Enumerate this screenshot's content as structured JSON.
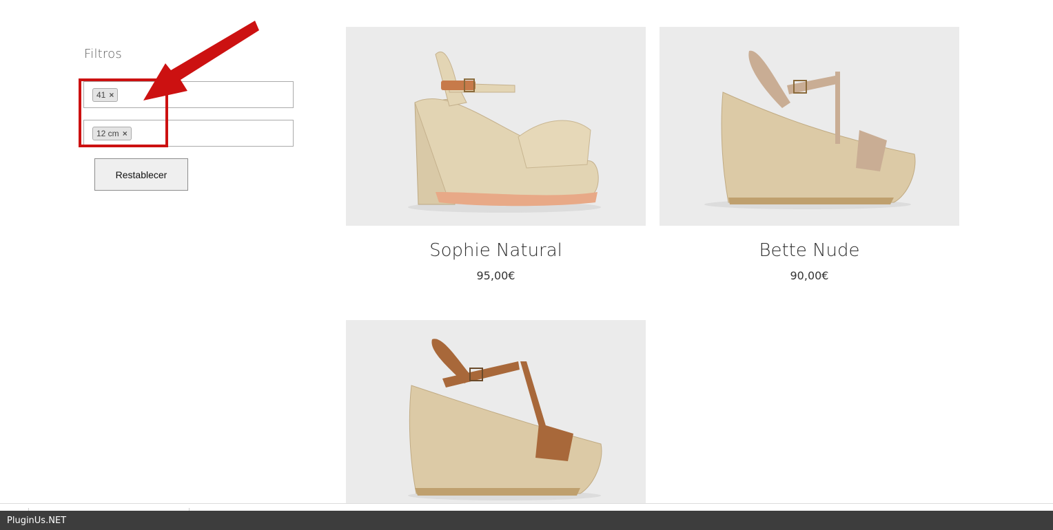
{
  "sidebar": {
    "title": "Filtros",
    "filters": [
      {
        "chip_label": "41",
        "chip_remove": "×"
      },
      {
        "chip_label": "12 cm",
        "chip_remove": "×"
      }
    ],
    "reset_label": "Restablecer"
  },
  "annotation": {
    "color": "#cc1111"
  },
  "products": [
    {
      "name": "Sophie Natural",
      "price": "95,00€"
    },
    {
      "name": "Bette Nude",
      "price": "90,00€"
    },
    {
      "name": "",
      "price": ""
    }
  ],
  "footer": {
    "brand": "PluginUs.NET"
  }
}
